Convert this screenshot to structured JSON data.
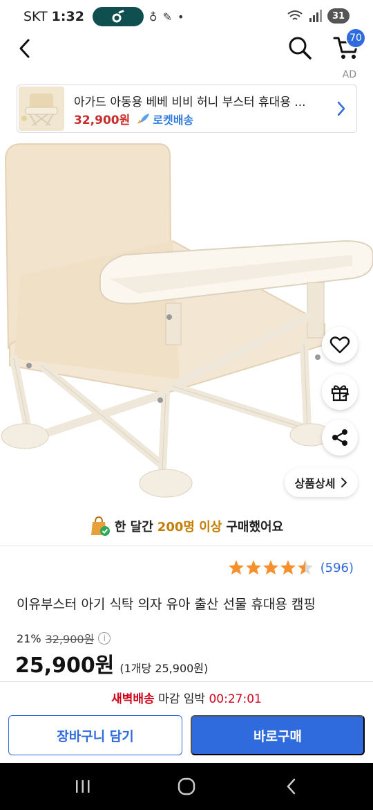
{
  "status_bar": {
    "carrier": "SKT",
    "time": "1:32",
    "battery": "31"
  },
  "top_nav": {
    "cart_count": "70"
  },
  "ad": {
    "label": "AD",
    "title": "아가드 아동용 베베 비비 허니 부스터 휴대용 ...",
    "price": "32,900원",
    "delivery_badge": "로켓배송"
  },
  "product": {
    "detail_button_label": "상품상세",
    "purchase_prefix": "한 달간",
    "purchase_count": "200명 이상",
    "purchase_suffix": "구매했어요",
    "rating": 4.5,
    "review_count": "(596)",
    "title": "이유부스터 아기 식탁 의자 유아 출산 선물 휴대용 캠핑",
    "discount_rate": "21%",
    "original_price": "32,900원",
    "sale_price": "25,900원",
    "unit_price": "(1개당 25,900원)"
  },
  "bottom": {
    "delivery_dawn": "새벽배송",
    "delivery_text": "마감 임박",
    "delivery_countdown": "00:27:01",
    "cart_button_label": "장바구니 담기",
    "buy_button_label": "바로구매"
  },
  "colors": {
    "accent_blue": "#2f6bdc",
    "price_red": "#c92b2b",
    "star_orange": "#f5902a",
    "highlight_orange": "#c57d00"
  },
  "icons": [
    "back-icon",
    "search-icon",
    "cart-icon",
    "chevron-right-icon",
    "heart-icon",
    "gift-icon",
    "share-icon",
    "rocket-icon",
    "shopping-bag-check-icon",
    "info-icon",
    "star-icon"
  ]
}
